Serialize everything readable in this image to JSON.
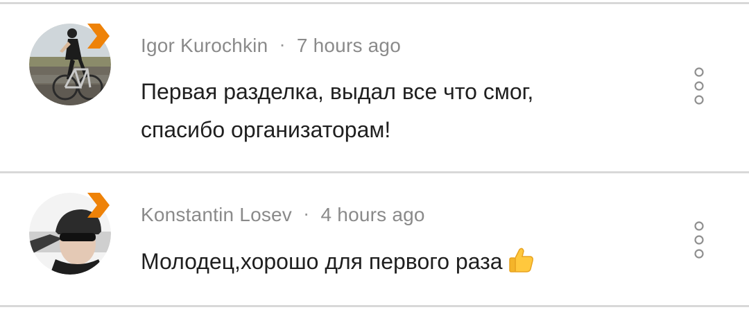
{
  "comments": [
    {
      "author": "Igor Kurochkin",
      "time": "7 hours ago",
      "text_lines": [
        "Первая разделка, выдал все что смог,",
        "спасибо организаторам!"
      ],
      "avatar_icon": "cyclist-avatar",
      "menu_icon": "more-vertical-icon"
    },
    {
      "author": "Konstantin Losev",
      "time": "4 hours ago",
      "text": "Молодец,хорошо для первого раза",
      "emoji_icon": "thumbs-up-icon",
      "avatar_icon": "helmet-avatar",
      "menu_icon": "more-vertical-icon"
    }
  ],
  "colors": {
    "badge": "#ee8208",
    "meta_text": "#8a8a8a",
    "body_text": "#1f1f1f",
    "divider": "#d8d8d8"
  }
}
